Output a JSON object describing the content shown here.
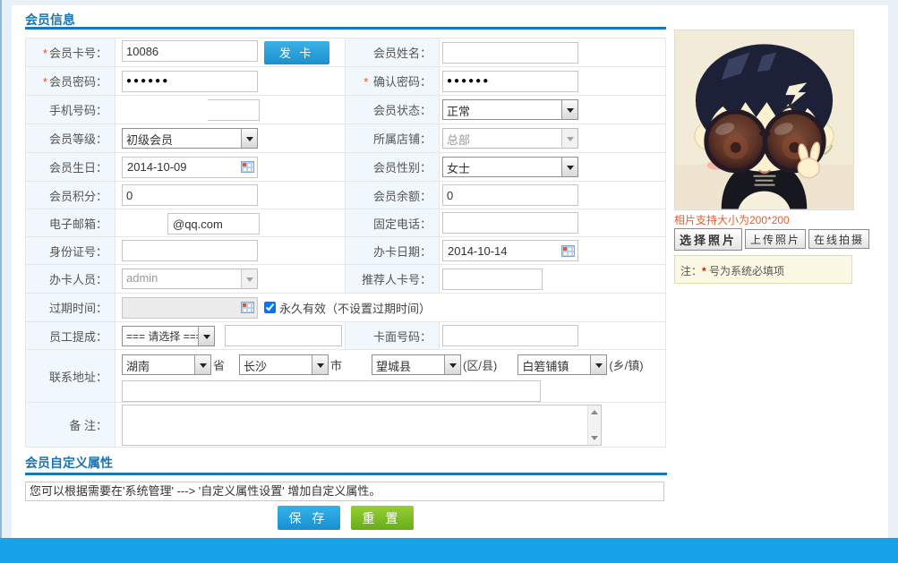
{
  "sections": {
    "member_info": {
      "title": "会员信息"
    },
    "custom_attrs": {
      "title": "会员自定义属性",
      "hint": "您可以根据需要在'系统管理' ---> '自定义属性设置' 增加自定义属性。"
    }
  },
  "form": {
    "required_mark": "*",
    "card_no": {
      "label": "会员卡号：",
      "value": "10086"
    },
    "issue_btn": "发 卡",
    "name": {
      "label": "会员姓名：",
      "value": ""
    },
    "password": {
      "label": "会员密码：",
      "value": "●●●●●●"
    },
    "confirm_password": {
      "label": "确认密码：",
      "value": "●●●●●●"
    },
    "mobile": {
      "label": "手机号码：",
      "value": ""
    },
    "status": {
      "label": "会员状态：",
      "value": "正常"
    },
    "level": {
      "label": "会员等级：",
      "value": "初级会员"
    },
    "store": {
      "label": "所属店铺：",
      "value": "总部"
    },
    "birthday": {
      "label": "会员生日：",
      "value": "2014-10-09"
    },
    "gender": {
      "label": "会员性别：",
      "value": "女士"
    },
    "points": {
      "label": "会员积分：",
      "value": "0"
    },
    "balance": {
      "label": "会员余额：",
      "value": "0"
    },
    "email": {
      "label": "电子邮箱：",
      "value": "@qq.com"
    },
    "phone": {
      "label": "固定电话：",
      "value": ""
    },
    "id_no": {
      "label": "身份证号：",
      "value": ""
    },
    "card_date": {
      "label": "办卡日期：",
      "value": "2014-10-14"
    },
    "operator": {
      "label": "办卡人员：",
      "value": "admin"
    },
    "referrer": {
      "label": "推荐人卡号：",
      "value": ""
    },
    "expire": {
      "label": "过期时间：",
      "value": "",
      "checked": "checked",
      "checkbox_label": "永久有效（不设置过期时间）"
    },
    "commission": {
      "label": "员工提成：",
      "select_value": "=== 请选择 ===",
      "value": ""
    },
    "card_face": {
      "label": "卡面号码：",
      "value": ""
    },
    "address": {
      "label": "联系地址：",
      "province": "湖南",
      "province_suffix": "省",
      "city": "长沙",
      "city_suffix": "市",
      "district": "望城县",
      "district_suffix": "(区/县)",
      "town": "白箬铺镇",
      "town_suffix": "(乡/镇)",
      "detail": ""
    },
    "remark": {
      "label": "备 注：",
      "value": ""
    }
  },
  "photo_panel": {
    "support_note": "相片支持大小为200*200",
    "choose_btn": "选择照片",
    "upload_btn": "上传照片",
    "capture_btn": "在线拍摄",
    "note_prefix": "注：",
    "note_star": "*",
    "note_text": " 号为系统必填项"
  },
  "actions": {
    "save": "保 存",
    "reset": "重 置"
  },
  "colors": {
    "accent_blue": "#1878b4",
    "footer_blue": "#17a2e8",
    "save_blue": "#1f9ad8",
    "reset_green": "#76b82a",
    "required_red": "#ff4a00",
    "photo_note_orange": "#e0622d"
  }
}
